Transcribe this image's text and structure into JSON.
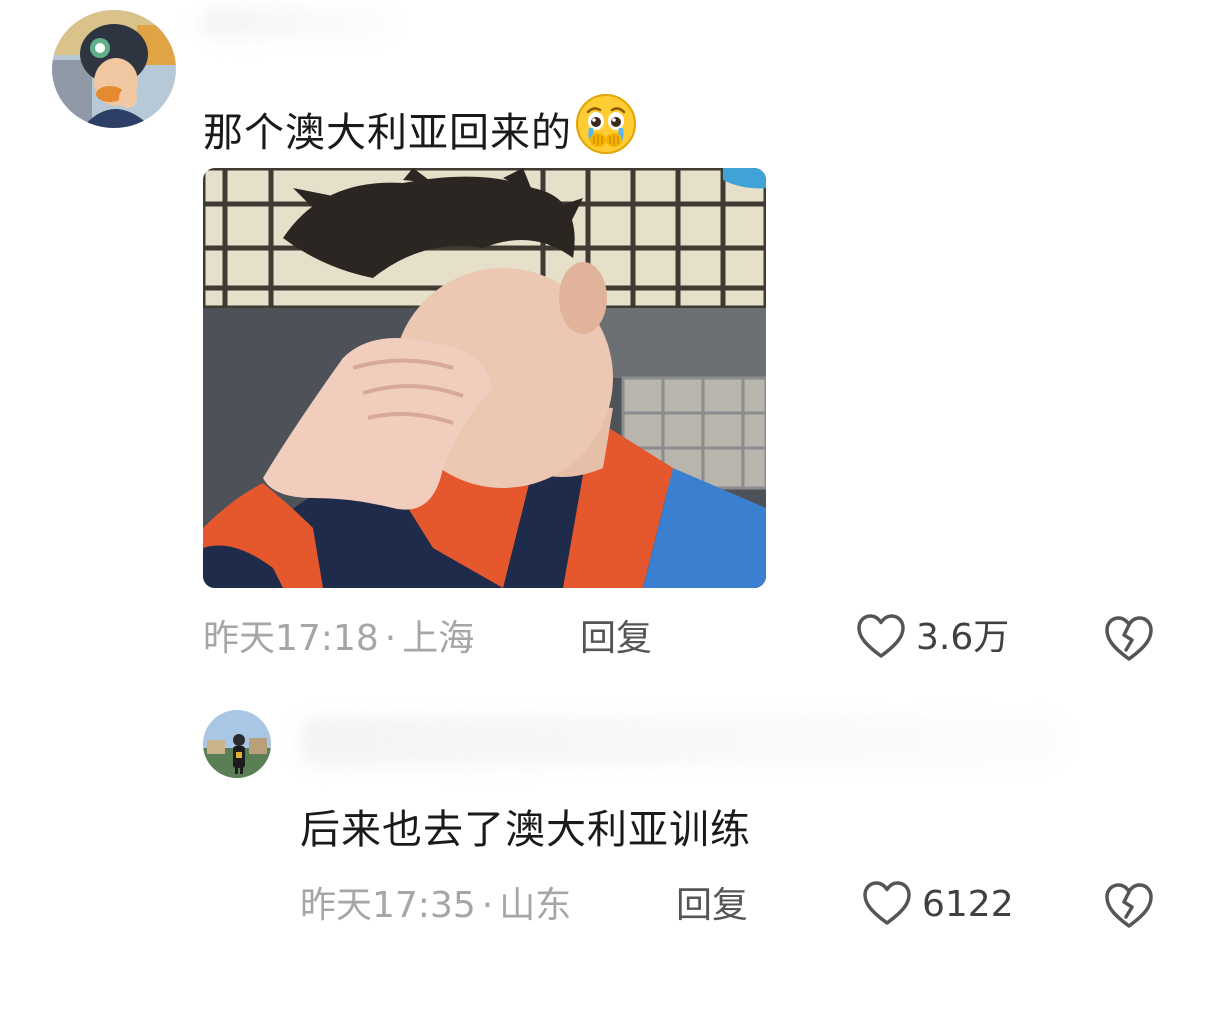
{
  "comments": [
    {
      "text": "那个澳大利亚回来的",
      "emoji": "pleading-tears-emoji",
      "time": "昨天17:18",
      "separator": "·",
      "location": "上海",
      "reply_label": "回复",
      "likes": "3.6万"
    },
    {
      "text": "后来也去了澳大利亚训练",
      "time": "昨天17:35",
      "separator": "·",
      "location": "山东",
      "reply_label": "回复",
      "likes": "6122"
    }
  ],
  "icons": {
    "like": "heart-outline-icon",
    "dislike": "broken-heart-icon"
  },
  "colors": {
    "meta_text": "#a6a6a6",
    "reply_text": "#555555",
    "icon_stroke": "#555555",
    "body_text": "#1a1a1a"
  }
}
